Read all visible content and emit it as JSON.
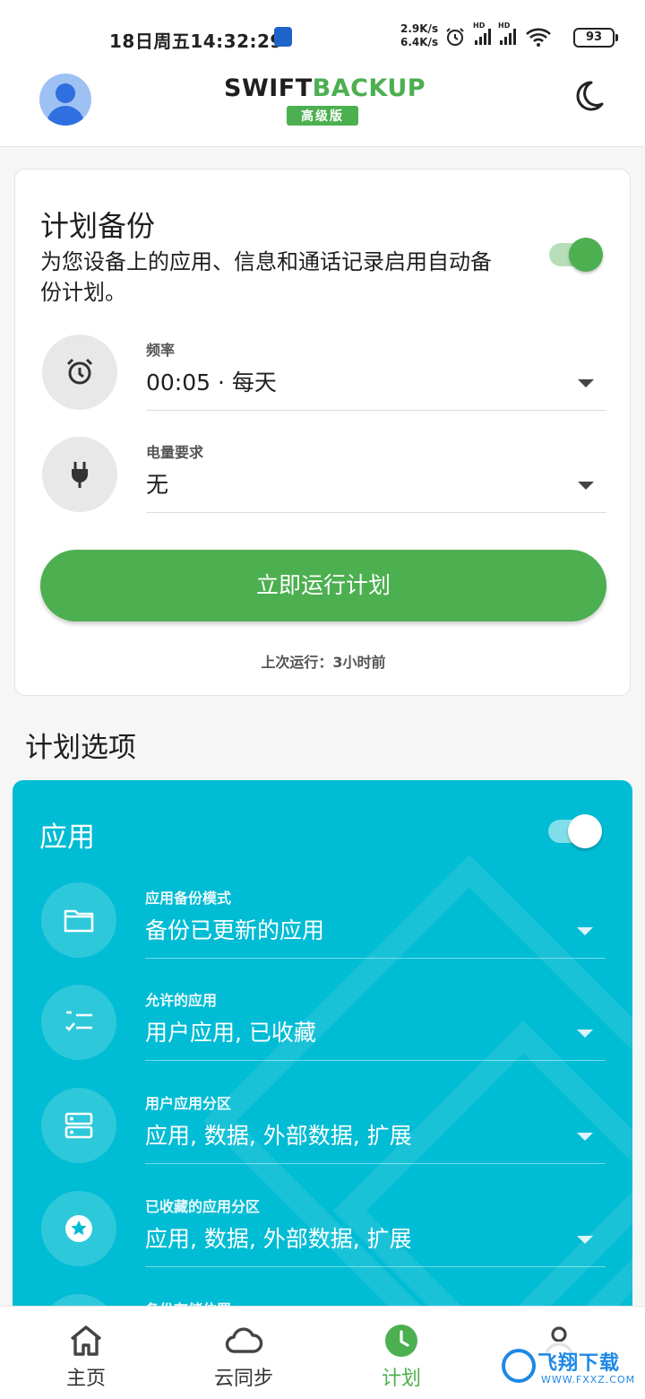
{
  "status_bar": {
    "time": "18日周五14:32:29",
    "speed_up": "2.9K/s",
    "speed_down": "6.4K/s",
    "network_badge": "HD",
    "battery": "93"
  },
  "header": {
    "logo_part1": "SWIFT",
    "logo_part2": "BACKUP",
    "badge": "高级版"
  },
  "schedule_card": {
    "title": "计划备份",
    "description": "为您设备上的应用、信息和通话记录启用自动备份计划。",
    "enabled": true,
    "frequency": {
      "label": "频率",
      "value": "00:05 · 每天"
    },
    "power": {
      "label": "电量要求",
      "value": "无"
    },
    "run_button": "立即运行计划",
    "last_run": "上次运行：3小时前"
  },
  "options_section_title": "计划选项",
  "apps_card": {
    "title": "应用",
    "enabled": true,
    "rows": [
      {
        "label": "应用备份模式",
        "value": "备份已更新的应用",
        "icon": "folder-icon"
      },
      {
        "label": "允许的应用",
        "value": "用户应用, 已收藏",
        "icon": "checklist-icon"
      },
      {
        "label": "用户应用分区",
        "value": "应用, 数据, 外部数据, 扩展",
        "icon": "storage-icon"
      },
      {
        "label": "已收藏的应用分区",
        "value": "应用, 数据, 外部数据, 扩展",
        "icon": "star-icon"
      },
      {
        "label": "备份存储位置",
        "value": "",
        "icon": "location-icon"
      }
    ]
  },
  "bottom_nav": [
    {
      "label": "主页",
      "icon": "home-icon"
    },
    {
      "label": "云同步",
      "icon": "cloud-icon"
    },
    {
      "label": "计划",
      "icon": "clock-icon",
      "active": true
    },
    {
      "label": "",
      "icon": "profile-icon"
    }
  ],
  "watermark": {
    "text": "飞翔下载",
    "url": "WWW.FXXZ.COM"
  },
  "colors": {
    "accent": "#4caf50",
    "teal": "#00bcd4"
  }
}
